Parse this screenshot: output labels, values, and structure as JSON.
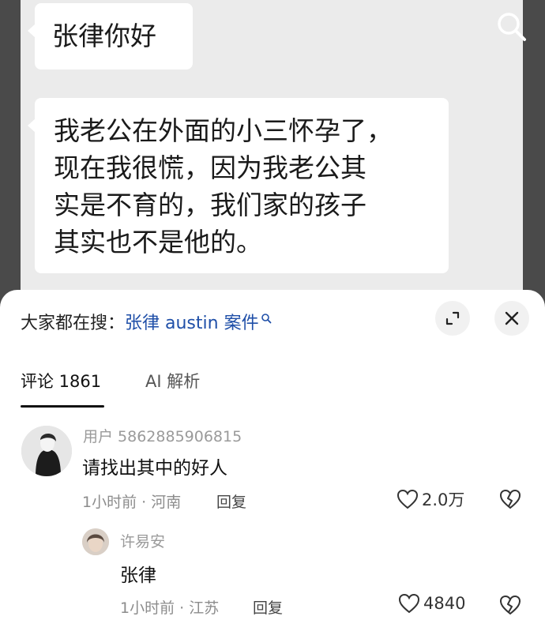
{
  "chat": {
    "greeting": "张律你好",
    "message_lines": [
      "我老公在外面的小三怀孕了，",
      "现在我很慌，因为我老公其",
      "实是不育的，我们家的孩子",
      "其实也不是他的。"
    ]
  },
  "sheet": {
    "search_prefix": "大家都在搜：",
    "search_link": "张律 austin 案件",
    "tabs": [
      {
        "label": "评论 1861",
        "active": true
      },
      {
        "label": "AI 解析",
        "active": false
      }
    ]
  },
  "comments": [
    {
      "user": "用户 5862885906815",
      "text": "请找出其中的好人",
      "meta": "1小时前 · 河南",
      "reply_label": "回复",
      "likes": "2.0万"
    },
    {
      "user": "许易安",
      "text": "张律",
      "meta": "1小时前 · 江苏",
      "reply_label": "回复",
      "likes": "4840"
    }
  ],
  "icons": {
    "search": "search-icon",
    "expand": "expand-icon",
    "close": "close-icon",
    "like": "heart-icon",
    "dislike": "broken-heart-icon"
  },
  "colors": {
    "link": "#1f4fa8",
    "chat_background": "#ebebeb",
    "sheet_background": "#ffffff"
  }
}
